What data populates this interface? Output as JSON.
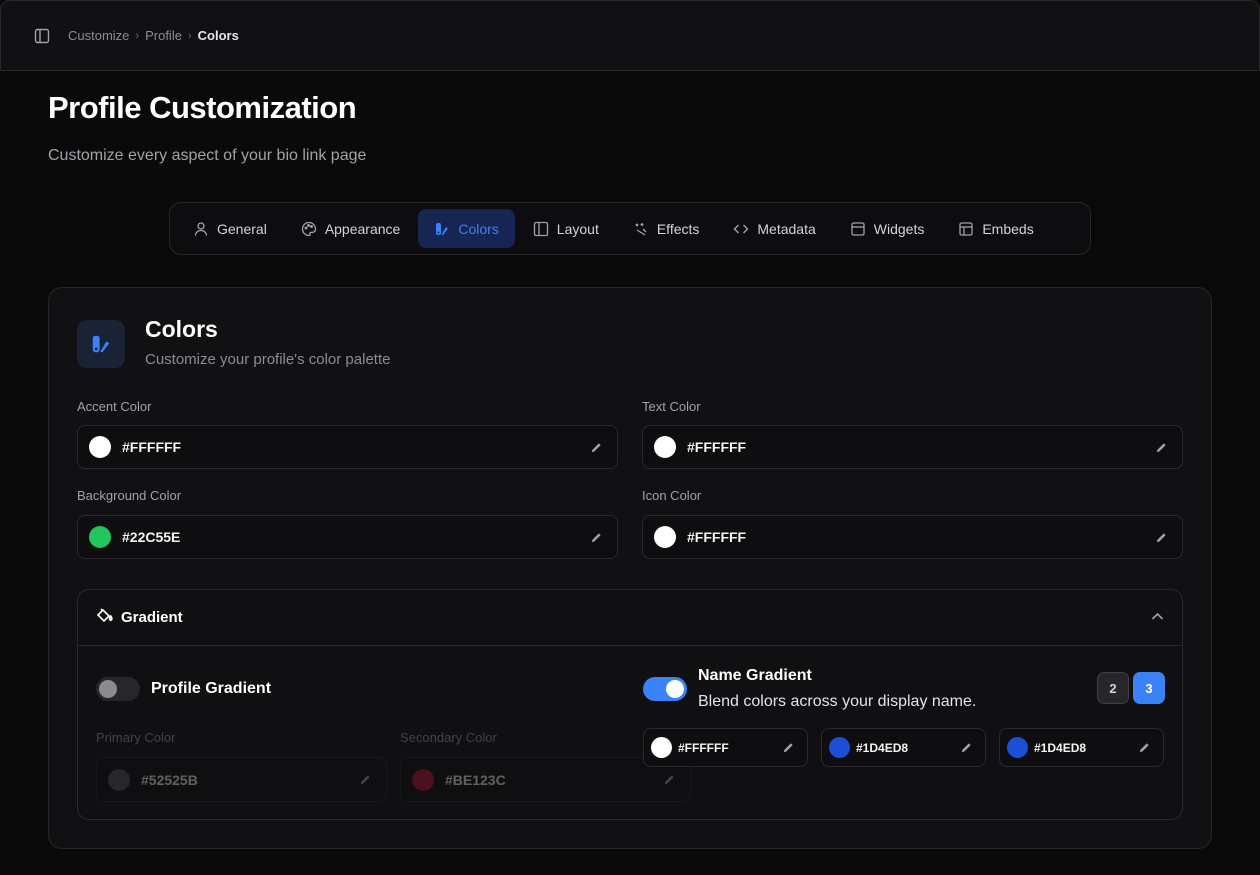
{
  "breadcrumb": [
    "Customize",
    "Profile",
    "Colors"
  ],
  "page": {
    "title": "Profile Customization",
    "subtitle": "Customize every aspect of your bio link page"
  },
  "tabs": [
    {
      "label": "General",
      "icon": "user-icon"
    },
    {
      "label": "Appearance",
      "icon": "palette-icon"
    },
    {
      "label": "Colors",
      "icon": "swatch-icon",
      "active": true
    },
    {
      "label": "Layout",
      "icon": "layout-icon"
    },
    {
      "label": "Effects",
      "icon": "sparkles-icon"
    },
    {
      "label": "Metadata",
      "icon": "code-icon"
    },
    {
      "label": "Widgets",
      "icon": "widget-icon"
    },
    {
      "label": "Embeds",
      "icon": "embed-icon"
    }
  ],
  "colors_card": {
    "title": "Colors",
    "subtitle": "Customize your profile's color palette",
    "fields": {
      "accent": {
        "label": "Accent Color",
        "value": "#FFFFFF"
      },
      "text": {
        "label": "Text Color",
        "value": "#FFFFFF"
      },
      "background": {
        "label": "Background Color",
        "value": "#22C55E"
      },
      "icon": {
        "label": "Icon Color",
        "value": "#FFFFFF"
      }
    }
  },
  "gradient": {
    "title": "Gradient",
    "profile": {
      "label": "Profile Gradient",
      "enabled": false,
      "primary": {
        "label": "Primary Color",
        "value": "#52525B"
      },
      "secondary": {
        "label": "Secondary Color",
        "value": "#BE123C"
      }
    },
    "name": {
      "label": "Name Gradient",
      "description": "Blend colors across your display name.",
      "enabled": true,
      "counts": [
        "2",
        "3"
      ],
      "selected_count": "3",
      "stops": [
        "#FFFFFF",
        "#1D4ED8",
        "#1D4ED8"
      ]
    }
  },
  "accent_color": "#3b82f6"
}
